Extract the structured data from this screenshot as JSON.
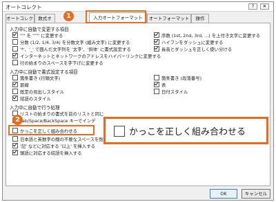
{
  "window": {
    "title": "オートコレクト",
    "help": "?",
    "close": "✕"
  },
  "tabs": [
    {
      "label": "オートコレクト"
    },
    {
      "label": "数式オ"
    },
    {
      "label": "入力オートフォーマット",
      "active": true
    },
    {
      "label": "オートフォーマット"
    },
    {
      "label": "操作"
    }
  ],
  "sections": {
    "replace": "入力中に自動で変更する項目",
    "apply": "入力中に自動で書式設定する項目",
    "auto": "入力中に自動で行う処理"
  },
  "replace_left": [
    {
      "label": "'\"\" を '“”' に変更する",
      "checked": true
    },
    {
      "label": "分数 (1/2, 1/4, 3/4) を分数文字 (組み文字) に変更する",
      "checked": false
    },
    {
      "label": "'*'、'_' で囲んだ文字列を '太字'、'斜体' に書式設定する",
      "checked": false
    },
    {
      "label": "インターネットとネットワークのアドレスをハイパーリンクに変更する",
      "checked": true
    },
    {
      "label": "行の始まりのスペースを字下げに変更する",
      "checked": false
    }
  ],
  "replace_right": [
    {
      "label": "序数 (1st, 2nd, 3rd, ...) を上付き文字に変更する",
      "checked": true
    },
    {
      "label": "ハイフンをダッシュに変更する",
      "checked": true
    },
    {
      "label": "長音とダッシュを正しく使い分ける",
      "checked": true
    }
  ],
  "apply_left": [
    {
      "label": "箇条書き (行頭文字)",
      "checked": false
    },
    {
      "label": "罫線",
      "checked": true
    },
    {
      "label": "既定の見出しスタイル",
      "checked": false
    },
    {
      "label": "結語のスタイル",
      "checked": true
    }
  ],
  "apply_right": [
    {
      "label": "箇条書き (段落番号)",
      "checked": false
    },
    {
      "label": "表",
      "checked": true
    },
    {
      "label": "日付スタイル",
      "checked": false
    }
  ],
  "auto_items": [
    {
      "label": "リストの始まりの書式を前のリストと同じ",
      "checked": false
    },
    {
      "label": "Tab/Space/BackSpace キーでインデ",
      "checked": false
    },
    {
      "label": "かっこを正しく組み合わせる",
      "checked": false
    },
    {
      "label": "日本語と英数字の間の不要なスペースを削除する",
      "checked": false
    },
    {
      "label": "'記' などに対応する '以上' を挿入する",
      "checked": true
    },
    {
      "label": "頭語に対応する結語を挿入する",
      "checked": true
    }
  ],
  "annotations": {
    "step1": "1",
    "step2": "2",
    "callout": "かっこを正しく組み合わせる",
    "accent": "#ea6b1e"
  },
  "buttons": {
    "ok": "OK",
    "cancel": "キャンセル"
  }
}
